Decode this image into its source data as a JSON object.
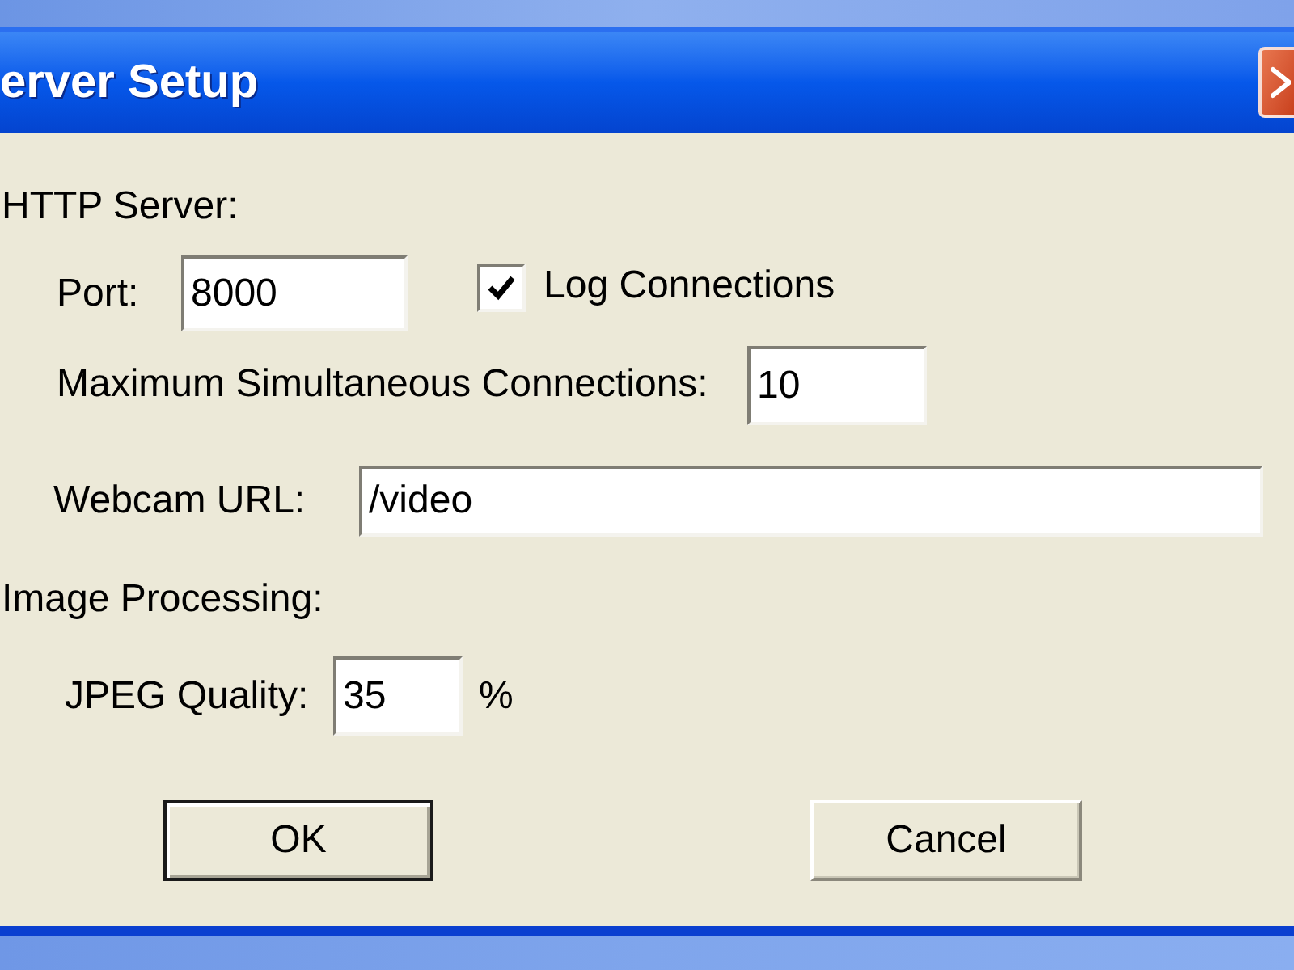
{
  "window": {
    "title": "erver Setup"
  },
  "http_server": {
    "heading": "HTTP Server:",
    "port": {
      "label": "Port:",
      "value": "8000"
    },
    "log_connections": {
      "label": "Log Connections",
      "checked": true
    },
    "max_connections": {
      "label": "Maximum Simultaneous Connections:",
      "value": "10"
    },
    "webcam_url": {
      "label": "Webcam URL:",
      "value": "/video"
    }
  },
  "image_processing": {
    "heading": "Image Processing:",
    "jpeg_quality": {
      "label": "JPEG Quality:",
      "value": "35",
      "unit": "%"
    }
  },
  "buttons": [
    {
      "label": "OK",
      "default": true
    },
    {
      "label": "Cancel",
      "default": false
    }
  ]
}
